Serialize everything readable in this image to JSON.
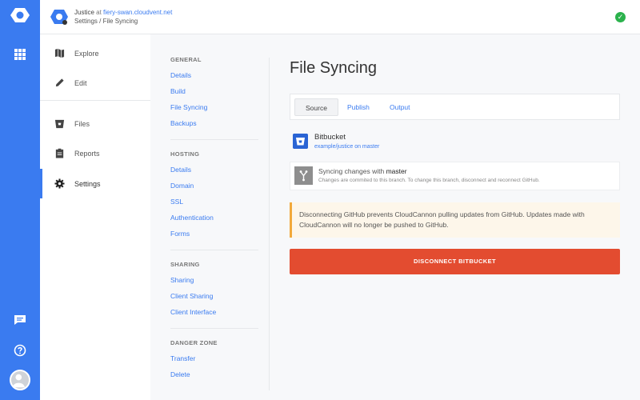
{
  "header": {
    "site_name": "Justice",
    "at": "at",
    "domain": "fiery-swan.cloudvent.net",
    "breadcrumb": "Settings / File Syncing"
  },
  "mainnav": {
    "items": [
      {
        "label": "Explore",
        "icon": "map-icon"
      },
      {
        "label": "Edit",
        "icon": "pencil-icon"
      },
      {
        "label": "Files",
        "icon": "bucket-icon"
      },
      {
        "label": "Reports",
        "icon": "clipboard-icon"
      },
      {
        "label": "Settings",
        "icon": "gear-icon"
      }
    ],
    "active": "Settings"
  },
  "subnav": {
    "general": {
      "title": "GENERAL",
      "links": [
        "Details",
        "Build",
        "File Syncing",
        "Backups"
      ]
    },
    "hosting": {
      "title": "HOSTING",
      "links": [
        "Details",
        "Domain",
        "SSL",
        "Authentication",
        "Forms"
      ]
    },
    "sharing": {
      "title": "SHARING",
      "links": [
        "Sharing",
        "Client Sharing",
        "Client Interface"
      ]
    },
    "danger": {
      "title": "DANGER ZONE",
      "links": [
        "Transfer",
        "Delete"
      ]
    }
  },
  "content": {
    "title": "File Syncing",
    "tabs": [
      "Source",
      "Publish",
      "Output"
    ],
    "selected_tab": "Source",
    "provider": {
      "name": "Bitbucket",
      "repo": "example/justice on master"
    },
    "sync": {
      "title_prefix": "Syncing changes with",
      "branch": "master",
      "description": "Changes are commited to this branch. To change this branch, disconnect and reconnect GitHub."
    },
    "warning": "Disconnecting GitHub prevents CloudCannon pulling updates from GitHub. Updates made with CloudCannon will no longer be pushed to GitHub.",
    "disconnect_label": "DISCONNECT BITBUCKET"
  },
  "colors": {
    "accent": "#3a7bf0",
    "danger": "#e34c30",
    "warning": "#f2a93b",
    "success": "#2bb24c",
    "bitbucket": "#2a64d4"
  }
}
